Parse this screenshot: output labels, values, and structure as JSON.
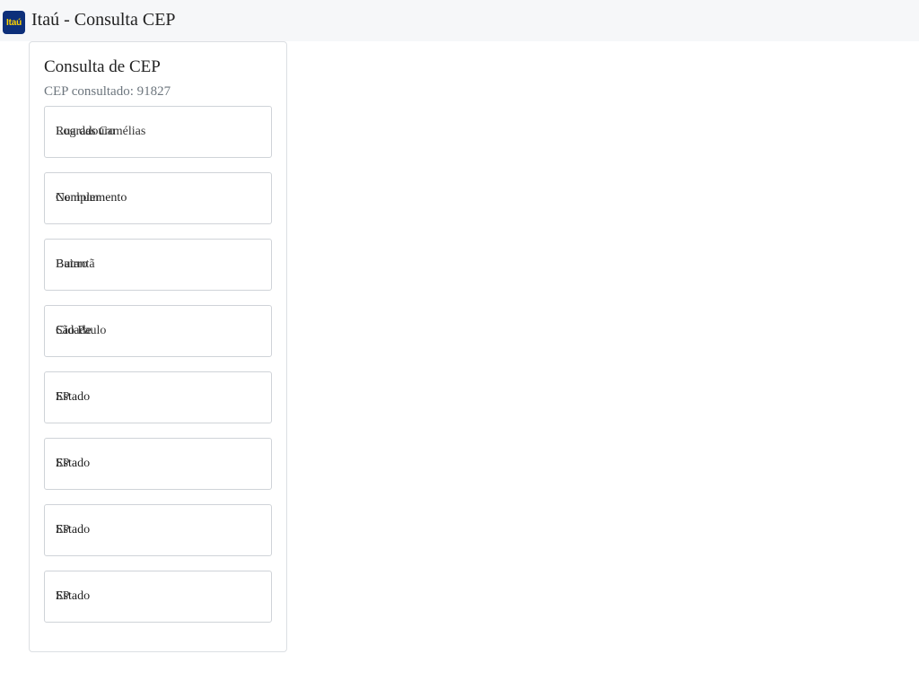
{
  "app": {
    "logo_text": "Itaú",
    "title": "Itaú - Consulta CEP"
  },
  "card": {
    "title": "Consulta de CEP",
    "subtitle": "CEP consultado: 91827"
  },
  "fields": [
    {
      "label": "Logradouro",
      "value": "Rua das Camélias"
    },
    {
      "label": "Complemento",
      "value": "Nenhum"
    },
    {
      "label": "Bairro",
      "value": "Butantã"
    },
    {
      "label": "Cidade",
      "value": "São Paulo"
    },
    {
      "label": "Estado",
      "value": "SP"
    },
    {
      "label": "Estado",
      "value": "SP"
    },
    {
      "label": "Estado",
      "value": "SP"
    },
    {
      "label": "Estado",
      "value": "SP"
    }
  ],
  "colors": {
    "brand_blue": "#0d2f7a",
    "brand_yellow": "#ffd200",
    "muted_text": "#6c757d",
    "border": "#cfd3d8"
  }
}
